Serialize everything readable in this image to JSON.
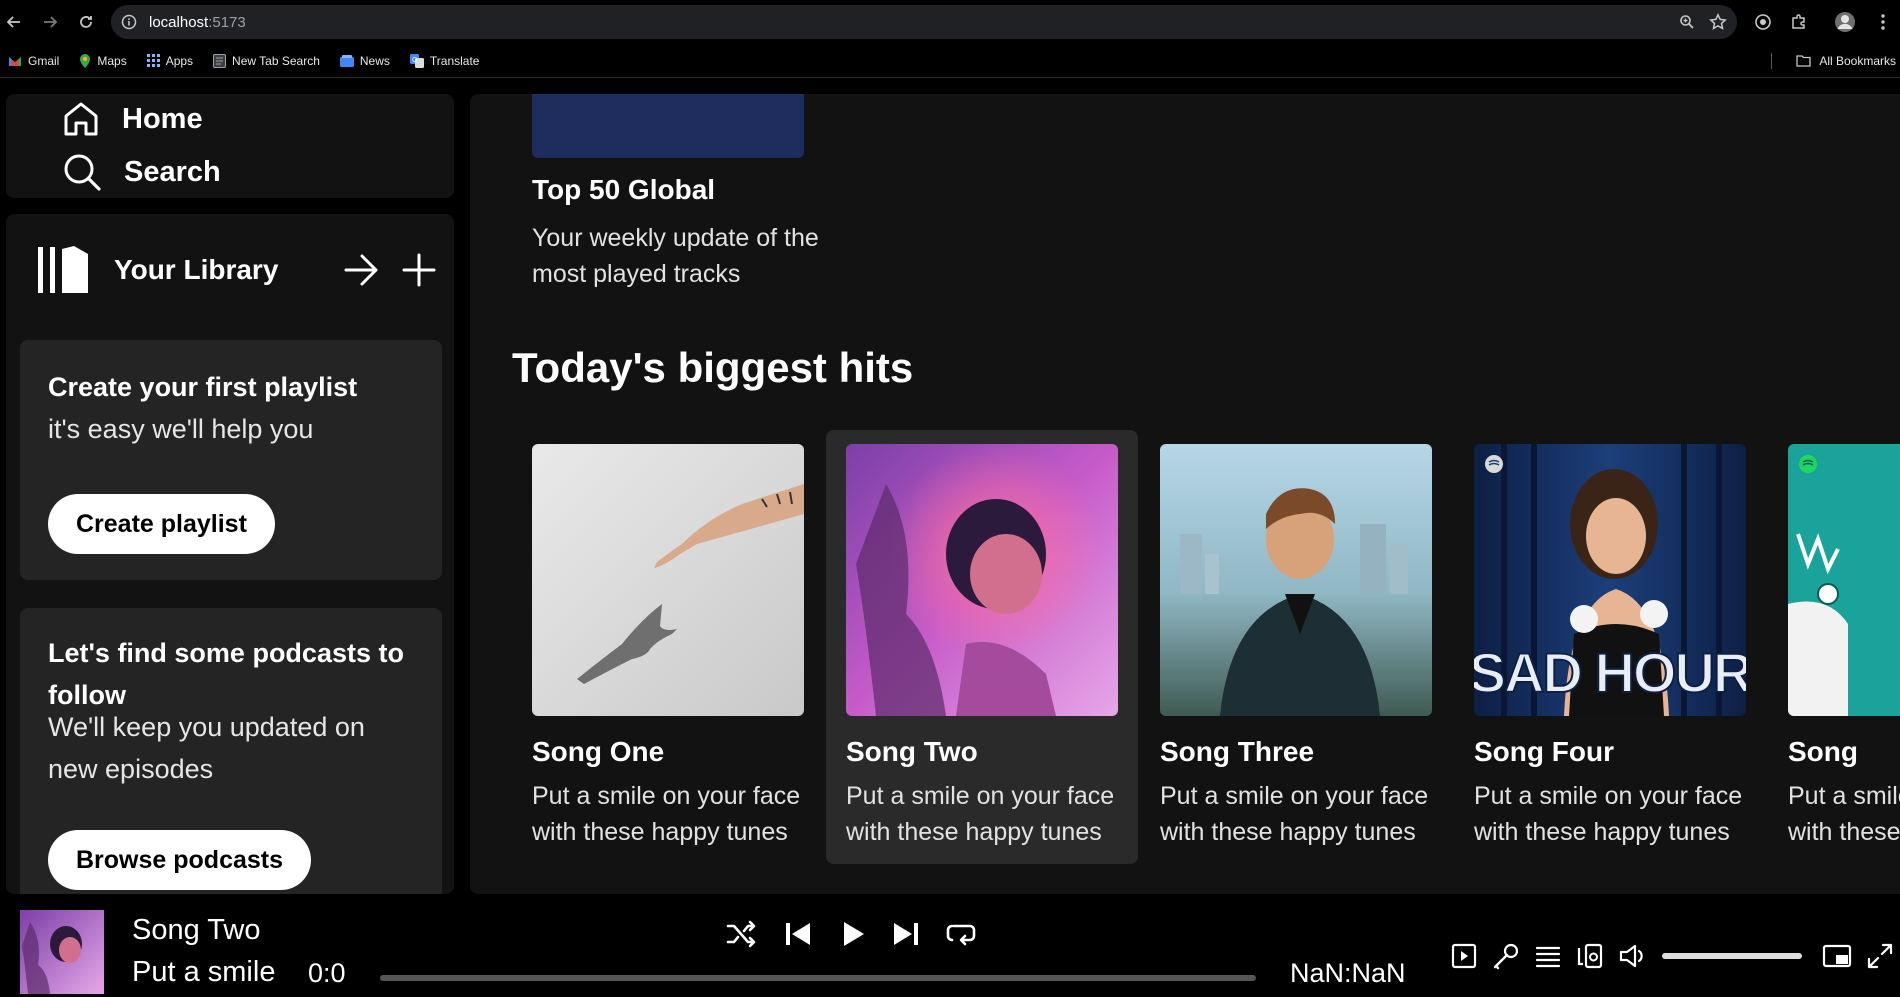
{
  "browser": {
    "url_host": "localhost",
    "url_port": ":5173",
    "bookmarks": [
      {
        "label": "Gmail",
        "color": "#ea4335"
      },
      {
        "label": "Maps",
        "color": "#34a853"
      },
      {
        "label": "Apps",
        "color": "#8ab4f8"
      },
      {
        "label": "New Tab Search",
        "color": "#9aa0a6"
      },
      {
        "label": "News",
        "color": "#4285f4"
      },
      {
        "label": "Translate",
        "color": "#4285f4"
      }
    ],
    "all_bookmarks": "All Bookmarks"
  },
  "nav": {
    "home": "Home",
    "search": "Search"
  },
  "library": {
    "title": "Your Library",
    "playlist_box": {
      "title": "Create your first playlist",
      "subtitle": "it's easy we'll help you",
      "button": "Create playlist"
    },
    "podcast_box": {
      "title": "Let's find some podcasts to follow",
      "subtitle": "We'll keep you updated on new episodes",
      "button": "Browse podcasts"
    }
  },
  "main": {
    "top_item": {
      "title": "Top 50 Global",
      "description": "Your weekly update of the most played tracks",
      "cover_color": "#1e2c5e"
    },
    "section_title": "Today's biggest hits",
    "cards": [
      {
        "title": "Song One",
        "description": "Put a smile on your face with these happy tunes",
        "cover": "hands"
      },
      {
        "title": "Song Two",
        "description": "Put a smile on your face with these happy tunes",
        "cover": "purple-portrait"
      },
      {
        "title": "Song Three",
        "description": "Put a smile on your face with these happy tunes",
        "cover": "man-city"
      },
      {
        "title": "Song Four",
        "description": "Put a smile on your face with these happy tunes",
        "cover": "sad-hour"
      },
      {
        "title": "Song",
        "description": "Put a smile on your face with these happy tunes",
        "cover": "teal-illustration"
      }
    ],
    "sad_hour_text": "SAD HOUR"
  },
  "player": {
    "title": "Song Two",
    "artist": "Put a smile",
    "time_current": "0:0",
    "time_total": "NaN:NaN",
    "progress": 0.0,
    "volume": 1.0
  },
  "colors": {
    "background": "#000000",
    "panel": "#121212",
    "card_box": "#242424",
    "active_card": "#2a2a2a"
  }
}
